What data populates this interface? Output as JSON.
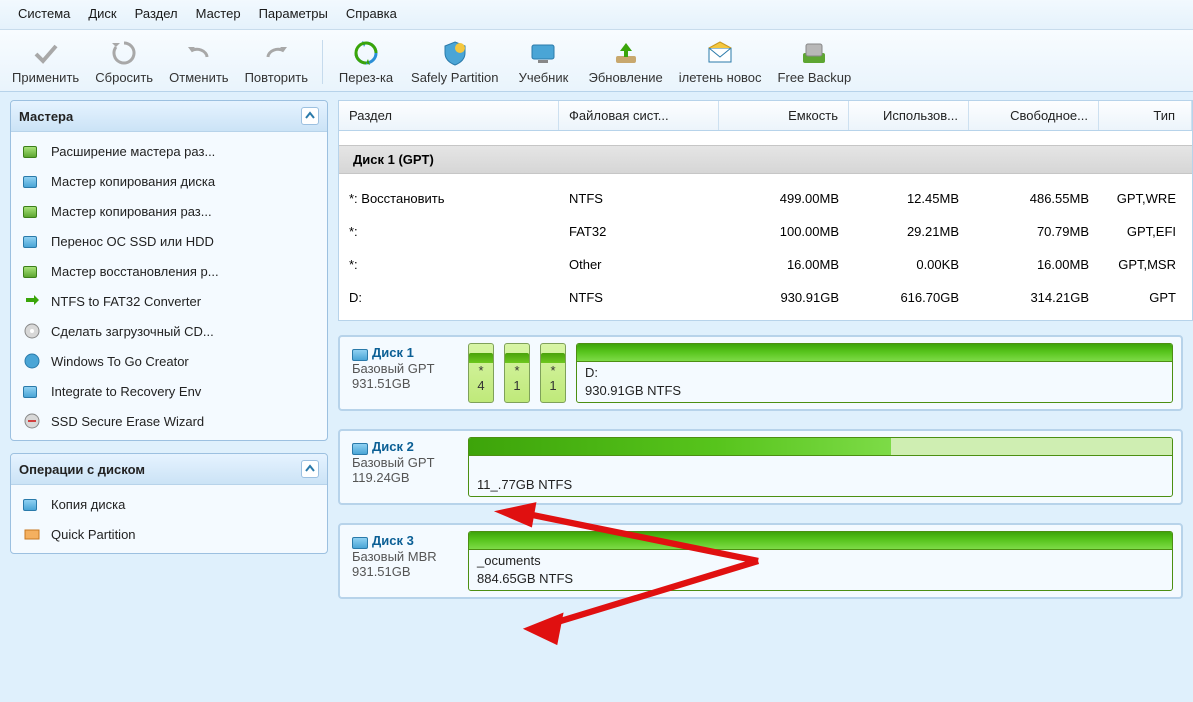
{
  "menu": [
    "Система",
    "Диск",
    "Раздел",
    "Мастер",
    "Параметры",
    "Справка"
  ],
  "toolbar": [
    {
      "id": "apply",
      "label": "Применить"
    },
    {
      "id": "reset",
      "label": "Сбросить"
    },
    {
      "id": "undo",
      "label": "Отменить"
    },
    {
      "id": "redo",
      "label": "Повторить"
    },
    {
      "id": "reload",
      "label": "Перез-ка"
    },
    {
      "id": "safely",
      "label": "Safely Partition"
    },
    {
      "id": "tutorial",
      "label": "Учебник"
    },
    {
      "id": "update",
      "label": "Эбновление"
    },
    {
      "id": "news",
      "label": "ілетень новос"
    },
    {
      "id": "backup",
      "label": "Free Backup"
    }
  ],
  "sidebar": {
    "wizards_title": "Мастера",
    "wizards": [
      "Расширение мастера раз...",
      "Мастер копирования диска",
      "Мастер копирования раз...",
      "Перенос ОС SSD или HDD",
      "Мастер восстановления р...",
      "NTFS to FAT32 Converter",
      "Сделать загрузочный CD...",
      "Windows To Go Creator",
      "Integrate to Recovery Env",
      "SSD Secure Erase Wizard"
    ],
    "ops_title": "Операции с диском",
    "ops": [
      "Копия диска",
      "Quick Partition"
    ]
  },
  "columns": {
    "c1": "Раздел",
    "c2": "Файловая сист...",
    "c3": "Емкость",
    "c4": "Использов...",
    "c5": "Свободное...",
    "c6": "Тип"
  },
  "disk1": {
    "header": "Диск 1 (GPT)",
    "rows": [
      {
        "p": "*: Восстановить",
        "fs": "NTFS",
        "cap": "499.00MB",
        "used": "12.45MB",
        "free": "486.55MB",
        "type": "GPT,WRE"
      },
      {
        "p": "*:",
        "fs": "FAT32",
        "cap": "100.00MB",
        "used": "29.21MB",
        "free": "70.79MB",
        "type": "GPT,EFI"
      },
      {
        "p": "*:",
        "fs": "Other",
        "cap": "16.00MB",
        "used": "0.00KB",
        "free": "16.00MB",
        "type": "GPT,MSR"
      },
      {
        "p": "D:",
        "fs": "NTFS",
        "cap": "930.91GB",
        "used": "616.70GB",
        "free": "314.21GB",
        "type": "GPT"
      }
    ]
  },
  "bars": {
    "d1": {
      "name": "Диск 1",
      "type": "Базовый GPT",
      "size": "931.51GB",
      "small": [
        "*",
        "*",
        "*",
        "4",
        "1",
        "1"
      ],
      "main_label": "D:",
      "main_sub": "930.91GB NTFS"
    },
    "d2": {
      "name": "Диск 2",
      "type": "Базовый GPT",
      "size": "119.24GB",
      "main_sub": "11_.77GB NTFS"
    },
    "d3": {
      "name": "Диск 3",
      "type": "Базовый MBR",
      "size": "931.51GB",
      "main_label": "_ocuments",
      "main_sub": "884.65GB NTFS"
    }
  }
}
